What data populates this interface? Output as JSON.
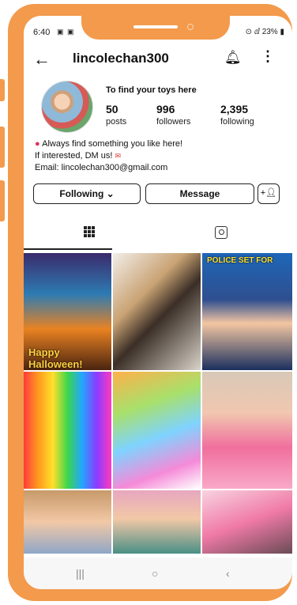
{
  "status": {
    "time": "6:40",
    "battery": "23%"
  },
  "header": {
    "username": "lincolechan300"
  },
  "profile": {
    "title": "To find your toys here",
    "posts": "50",
    "posts_label": "posts",
    "followers": "996",
    "followers_label": "followers",
    "following": "2,395",
    "following_label": "following",
    "bio_line1": "Always find something you like here!",
    "bio_line2": "If interested, DM us!",
    "bio_line3": "Email: lincolechan300@gmail.com"
  },
  "actions": {
    "following": "Following ⌄",
    "message": "Message"
  },
  "posts": [
    {
      "caption": "Happy Halloween!"
    },
    {
      "caption": ""
    },
    {
      "caption": "POLICE SET FOR"
    },
    {
      "caption": ""
    },
    {
      "caption": ""
    },
    {
      "caption": ""
    },
    {
      "caption": ""
    },
    {
      "caption": ""
    },
    {
      "caption": ""
    }
  ],
  "colors": {
    "frame": "#f39a4c",
    "text": "#111111"
  }
}
